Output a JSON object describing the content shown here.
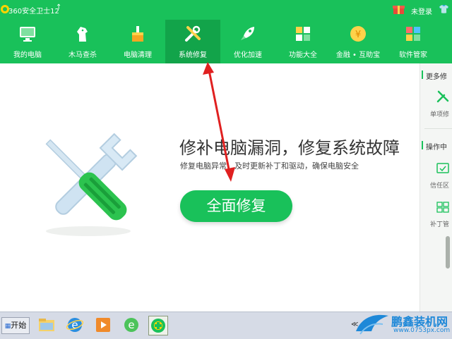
{
  "app": {
    "title": "360安全卫士12",
    "login_text": "未登录"
  },
  "nav": {
    "items": [
      {
        "label": "我的电脑",
        "icon": "monitor-icon"
      },
      {
        "label": "木马查杀",
        "icon": "horse-icon"
      },
      {
        "label": "电脑清理",
        "icon": "broom-icon"
      },
      {
        "label": "系统修复",
        "icon": "wrench-icon",
        "active": true
      },
      {
        "label": "优化加速",
        "icon": "rocket-icon"
      },
      {
        "label": "功能大全",
        "icon": "grid-icon"
      },
      {
        "label": "金融 • 互助宝",
        "icon": "coin-icon"
      },
      {
        "label": "软件管家",
        "icon": "apps-icon"
      }
    ]
  },
  "main": {
    "title": "修补电脑漏洞，修复系统故障",
    "subtitle": "修复电脑异常，及时更新补丁和驱动，确保电脑安全",
    "action_label": "全面修复"
  },
  "right_panel": {
    "section1_title": "更多修",
    "item1_label": "单项修",
    "section2_title": "操作中",
    "item2_label": "信任区",
    "item3_label": "补丁管"
  },
  "taskbar": {
    "start_label": "开始"
  },
  "watermark": {
    "title": "鹏鑫装机网",
    "url": "www.0753px.com"
  },
  "colors": {
    "brand_green": "#19c15a",
    "active_green": "#12a44a",
    "annotation_red": "#e02020"
  }
}
